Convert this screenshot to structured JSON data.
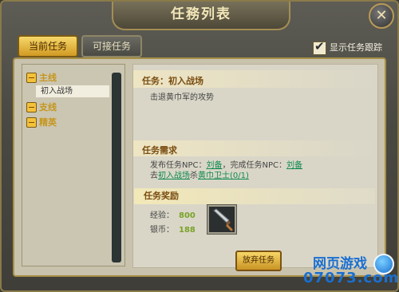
{
  "window": {
    "title": "任務列表",
    "close_symbol": "✕"
  },
  "tabs": {
    "current": "当前任务",
    "available": "可接任务"
  },
  "track_option": {
    "label": "显示任务跟踪",
    "checked": true
  },
  "quest_tree": {
    "categories": [
      {
        "label": "主线",
        "expanded": true
      },
      {
        "label": "支线",
        "expanded": true
      },
      {
        "label": "精英",
        "expanded": true
      }
    ],
    "selected_quest": "初入战场"
  },
  "quest_detail": {
    "heading": "任务：初入战场",
    "description": "击退黄巾军的攻势",
    "requirement_heading": "任务需求",
    "line1_prefix": "发布任务NPC：",
    "line1_npc1": "刘备",
    "line1_middle": "，完成任务NPC：",
    "line1_npc2": "刘备",
    "line2_prefix": "去",
    "line2_place": "初入战场",
    "line2_middle": "杀",
    "line2_target": "黄巾卫士(0/1)",
    "reward_heading": "任务奖励",
    "exp_label": "经验：",
    "exp_value": "800",
    "coin_label": "银币：",
    "coin_value": "188",
    "reward_item_icon": "sword-icon",
    "abandon_label": "放弃任务"
  },
  "watermark": {
    "line1": "网页游戏",
    "line2": "07073.com"
  }
}
